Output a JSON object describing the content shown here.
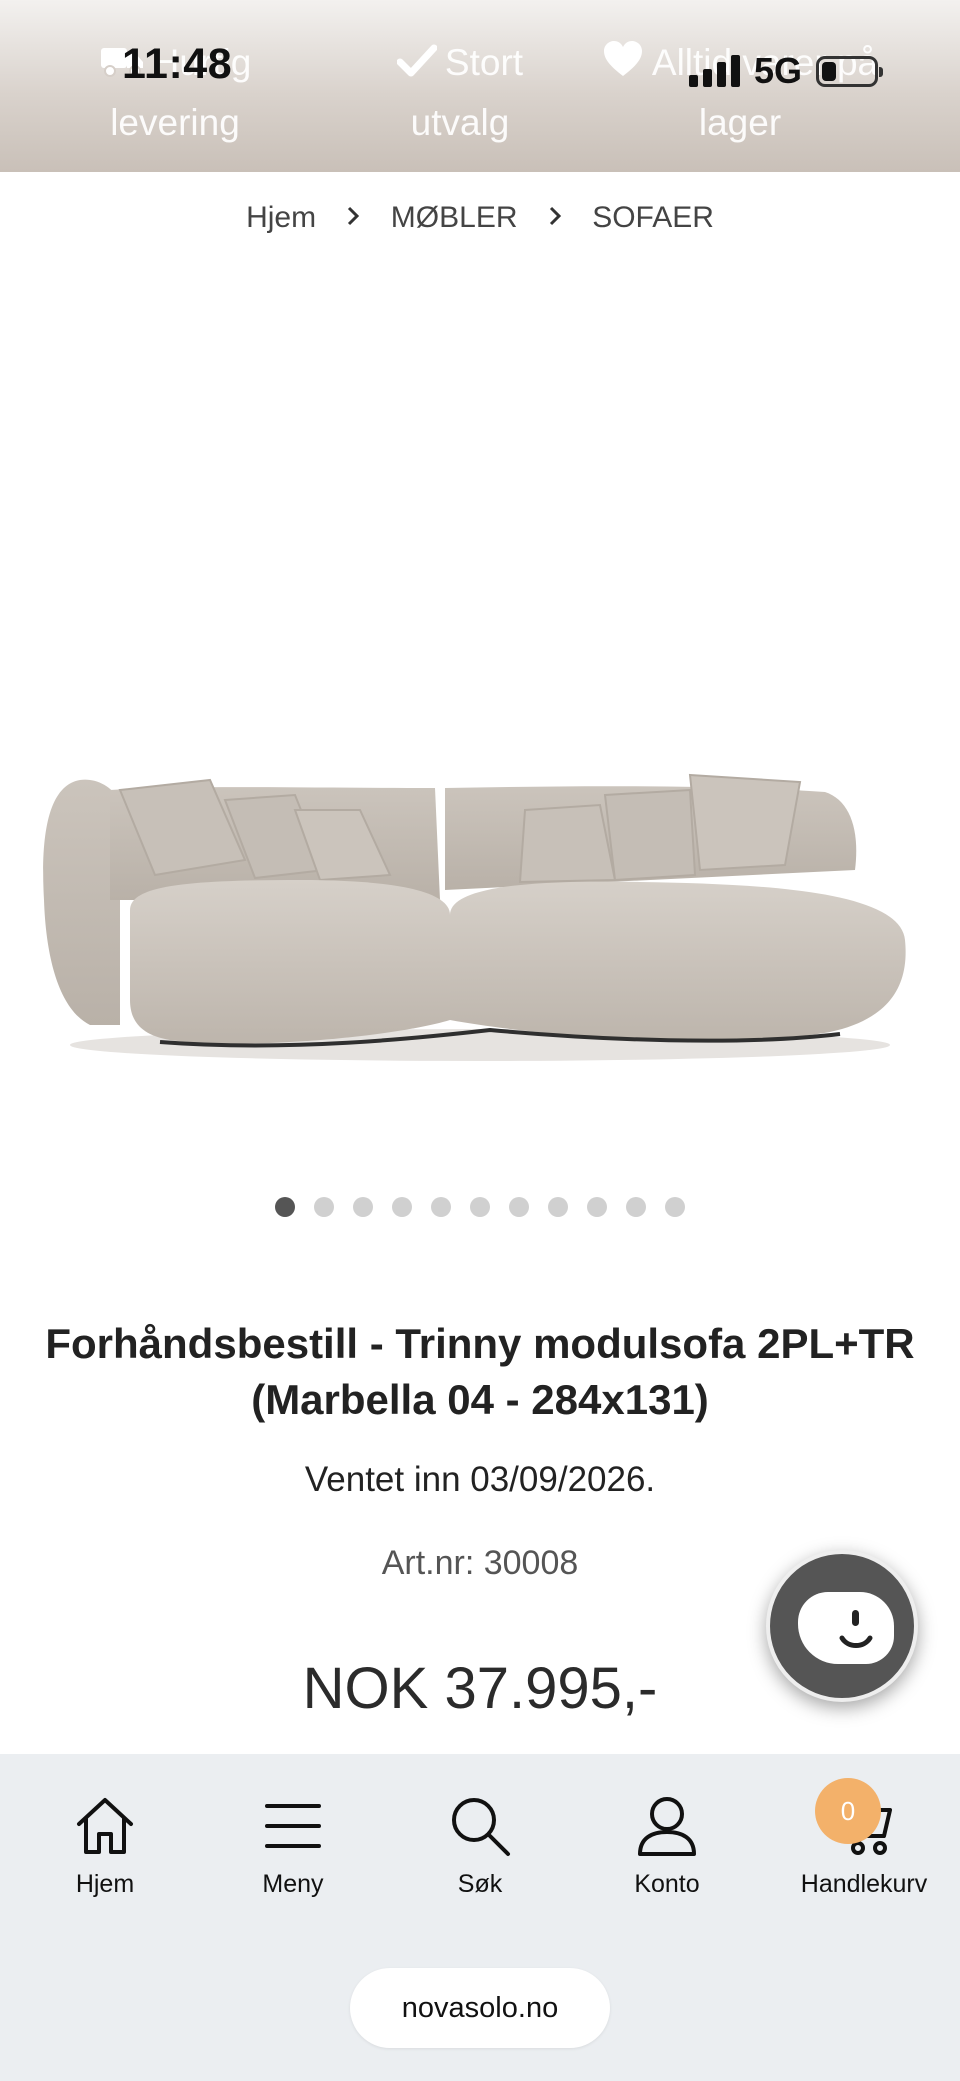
{
  "status_bar": {
    "time": "11:48",
    "network": "5G"
  },
  "usp_banner": {
    "items": [
      {
        "icon": "truck-icon",
        "line1": "Hurtig",
        "line2": "levering"
      },
      {
        "icon": "check-icon",
        "line1": "Stort",
        "line2": "utvalg"
      },
      {
        "icon": "heart-icon",
        "line1": "Alltid varer på",
        "line2": "lager"
      }
    ]
  },
  "breadcrumb": {
    "items": [
      "Hjem",
      "MØBLER",
      "SOFAER"
    ]
  },
  "gallery": {
    "dot_count": 11,
    "active_index": 0
  },
  "product": {
    "title_line1": "Forhåndsbestill - Trinny modulsofa 2PL+TR",
    "title_line2": "(Marbella 04 - 284x131)",
    "availability": "Ventet inn 03/09/2026.",
    "art_nr": "Art.nr: 30008",
    "price": "NOK 37.995,-"
  },
  "bottom_nav": {
    "home": "Hjem",
    "menu": "Meny",
    "search": "Søk",
    "account": "Konto",
    "cart": "Handlekurv",
    "cart_count": "0"
  },
  "browser": {
    "url": "novasolo.no"
  },
  "colors": {
    "accent_badge": "#f3b16a",
    "nav_bg": "#ebeef1",
    "sofa": "#cfc8c0"
  }
}
